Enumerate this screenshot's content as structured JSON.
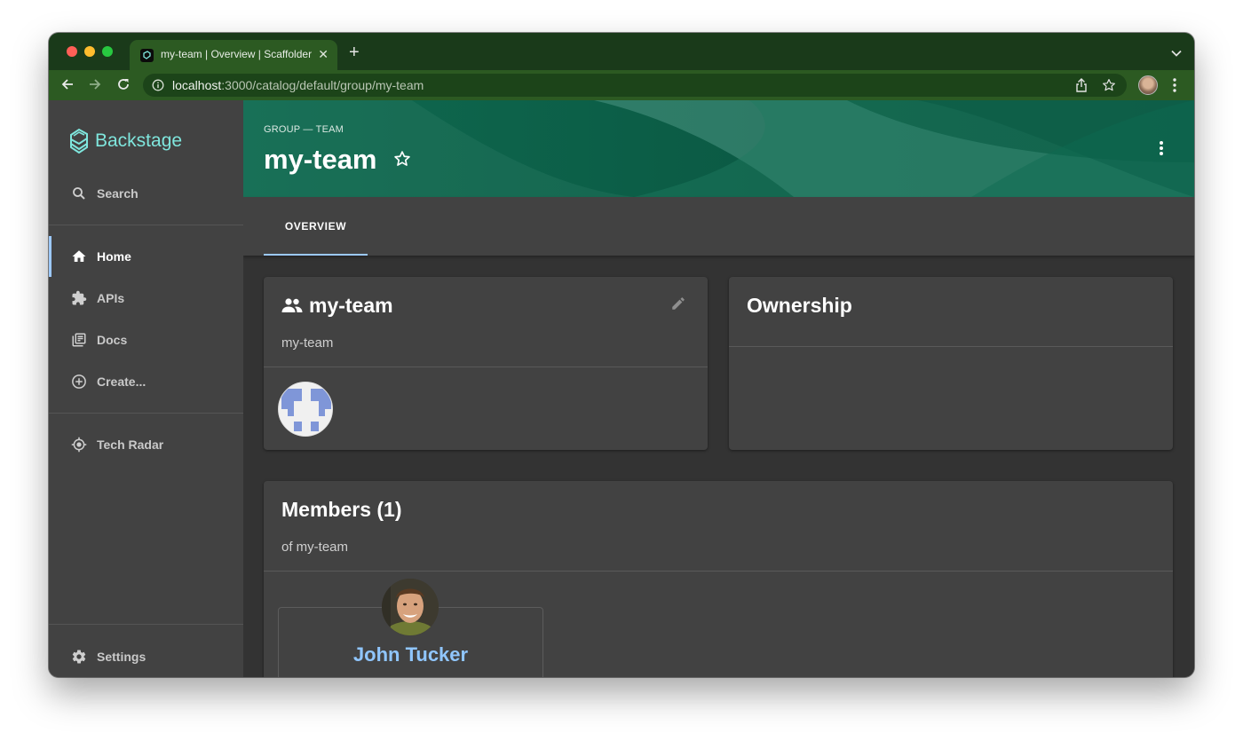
{
  "browser": {
    "tab_title": "my-team | Overview | Scaffolder",
    "url_host": "localhost",
    "url_path": ":3000/catalog/default/group/my-team",
    "icons": [
      "back-icon",
      "forward-icon",
      "reload-icon",
      "info-icon",
      "share-icon",
      "bookmark-star-icon",
      "profile-avatar",
      "browser-menu-icon"
    ]
  },
  "sidebar": {
    "logo_text": "Backstage",
    "search_label": "Search",
    "items": [
      {
        "label": "Home",
        "icon": "home-icon",
        "active": true
      },
      {
        "label": "APIs",
        "icon": "puzzle-icon"
      },
      {
        "label": "Docs",
        "icon": "library-icon"
      },
      {
        "label": "Create...",
        "icon": "add-circle-icon"
      }
    ],
    "tech_radar_label": "Tech Radar",
    "settings_label": "Settings"
  },
  "header": {
    "kind": "GROUP — TEAM",
    "title": "my-team"
  },
  "tabs": [
    {
      "label": "OVERVIEW",
      "active": true
    }
  ],
  "group_card": {
    "title": "my-team",
    "subtitle": "my-team"
  },
  "ownership_card": {
    "title": "Ownership"
  },
  "members_card": {
    "title": "Members (1)",
    "subtitle": "of my-team",
    "members": [
      {
        "name": "John Tucker"
      }
    ]
  },
  "colors": {
    "accent": "#9cc9ff",
    "header_bg": "#0c5c45",
    "logo": "#7fe6dd",
    "member_name": "#90c6ff"
  }
}
